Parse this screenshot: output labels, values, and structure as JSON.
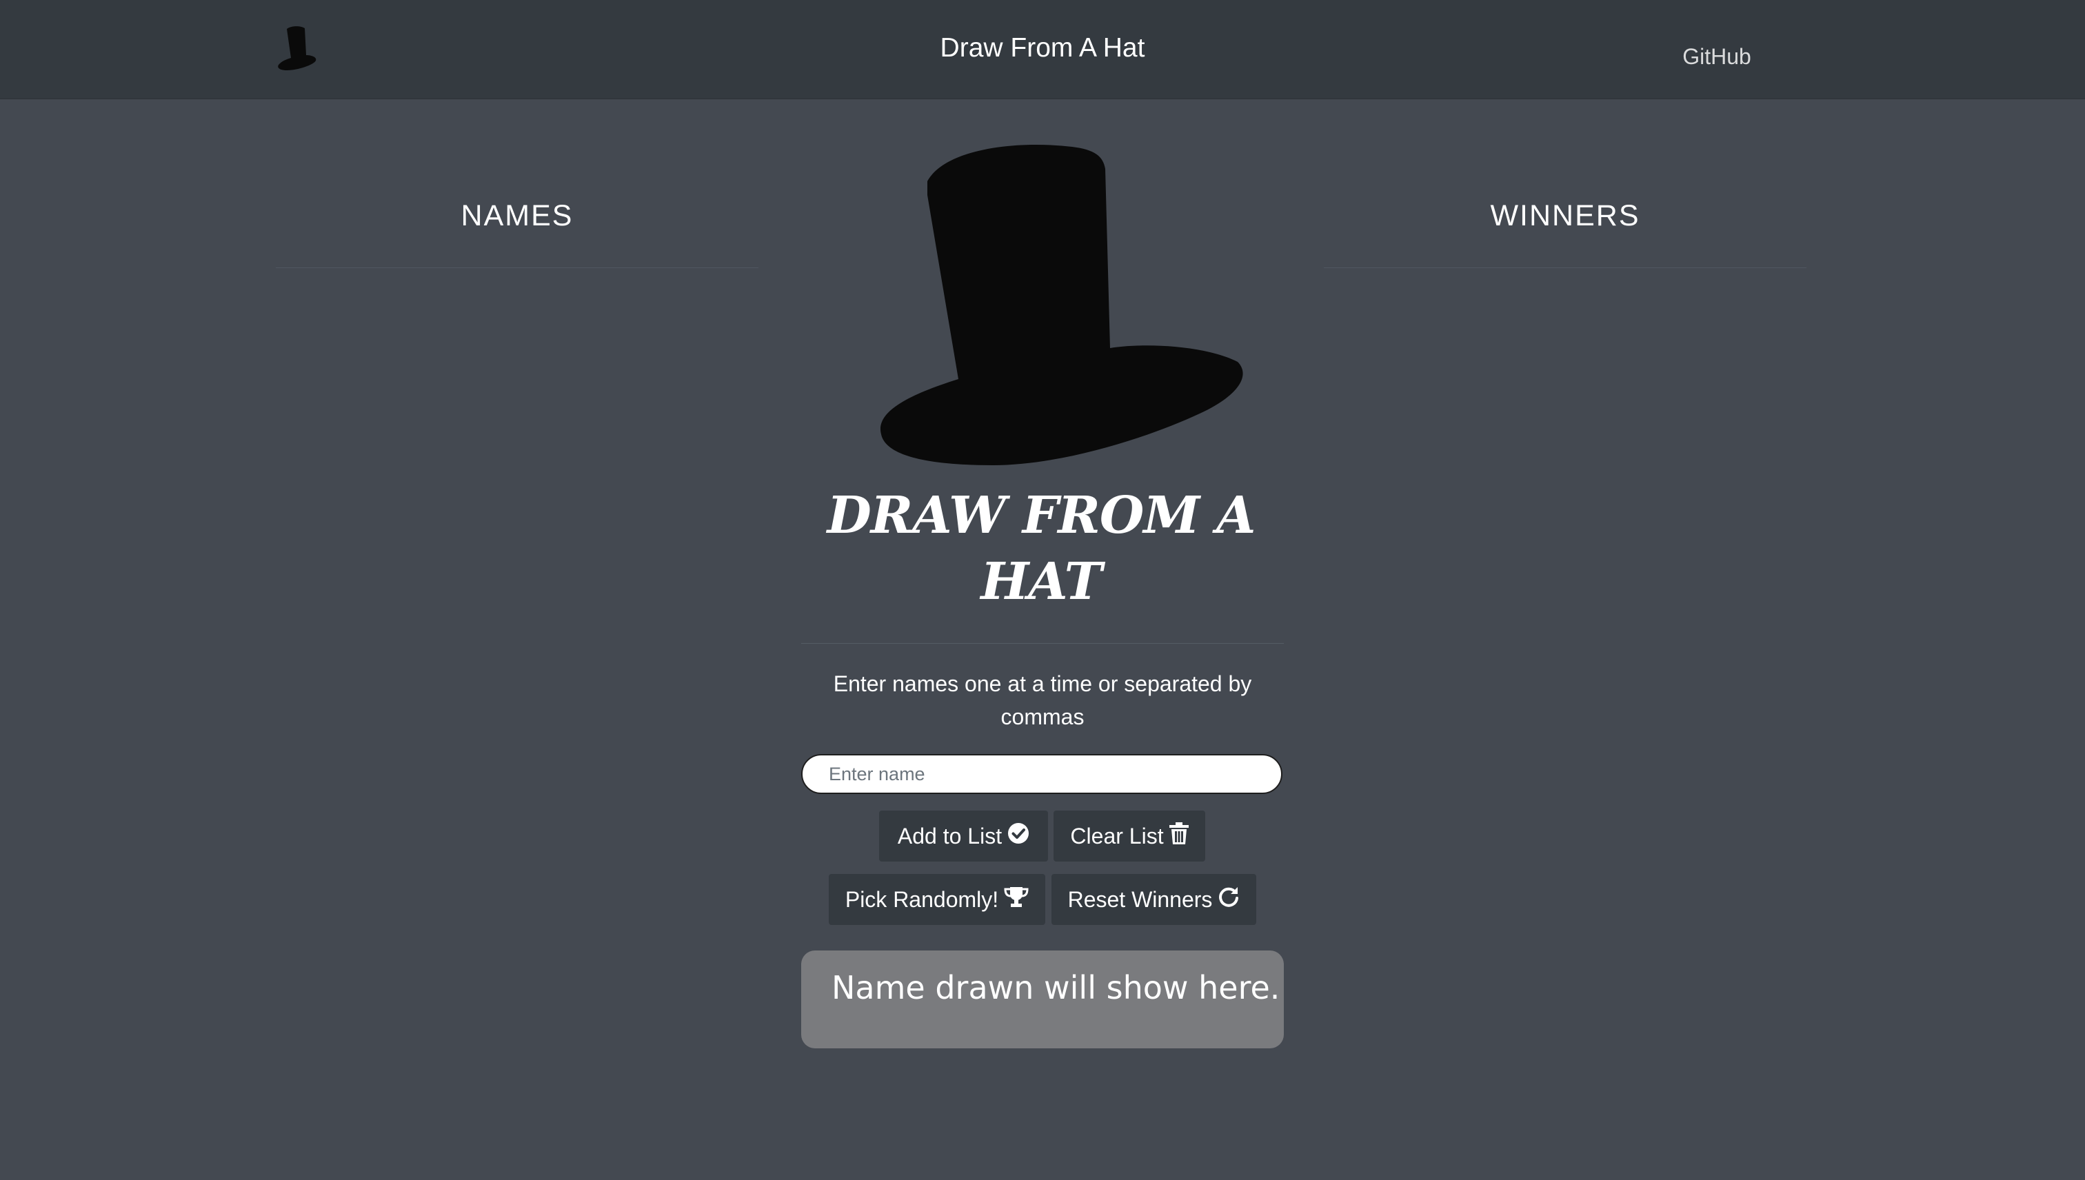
{
  "navbar": {
    "logo_icon": "top-hat-icon",
    "title": "Draw From A Hat",
    "github_label": "GitHub"
  },
  "names_column": {
    "heading": "NAMES",
    "items": []
  },
  "winners_column": {
    "heading": "WINNERS",
    "items": []
  },
  "hero": {
    "image_icon": "top-hat-icon",
    "title": "DRAW FROM A HAT",
    "instructions": "Enter names one at a time or separated by commas"
  },
  "form": {
    "name_input_placeholder": "Enter name",
    "name_input_value": ""
  },
  "buttons": {
    "add_label": "Add to List",
    "add_icon": "check-circle-icon",
    "clear_label": "Clear List",
    "clear_icon": "trash-icon",
    "pick_label": "Pick Randomly!",
    "pick_icon": "trophy-icon",
    "reset_label": "Reset Winners",
    "reset_icon": "redo-icon"
  },
  "result": {
    "text": "Name drawn will show here."
  },
  "colors": {
    "background": "#444951",
    "navbar": "#343a40",
    "button": "#343a40",
    "result_box": "#7a7b7e",
    "hat": "#0a0a0a"
  }
}
